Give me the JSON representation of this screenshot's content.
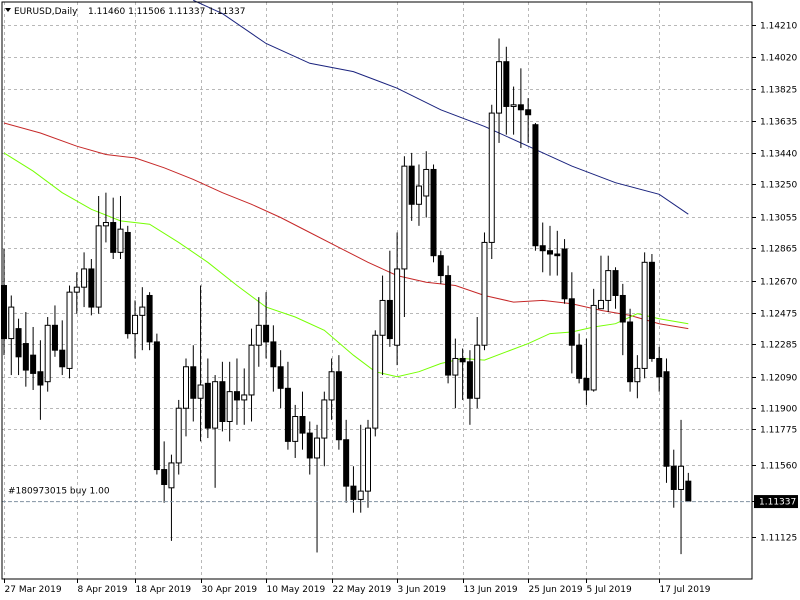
{
  "header": {
    "symbol_label": "EURUSD,Daily",
    "ohlc_label": "1.11460 1.11506 1.11337 1.11337"
  },
  "trade": {
    "label": "#180973015 buy 1.00",
    "price": 1.11337
  },
  "current_price": {
    "label": "1.11337",
    "value": 1.11337
  },
  "colors": {
    "background": "#ffffff",
    "grid": "#b8b8b8",
    "candle": "#000000",
    "ma_long": "#1a237e",
    "ma_mid": "#c62828",
    "ma_short": "#76ff03",
    "trade_line": "#8a9aaa",
    "price_label_bg": "#000000",
    "price_label_text": "#ffffff"
  },
  "chart_data": {
    "type": "candlestick",
    "title": "EURUSD,Daily",
    "ylim": [
      1.1087,
      1.1435
    ],
    "y_ticks": [
      1.11125,
      1.1134,
      1.1156,
      1.11775,
      1.119,
      1.1209,
      1.12285,
      1.12475,
      1.1267,
      1.12865,
      1.13055,
      1.1325,
      1.1344,
      1.13635,
      1.13825,
      1.1402,
      1.1421
    ],
    "y_tick_labels": [
      "1.11125",
      "",
      "1.11560",
      "1.11775",
      "1.11900",
      "1.12090",
      "1.12285",
      "1.12475",
      "1.12670",
      "1.12865",
      "1.13055",
      "1.13250",
      "1.13440",
      "1.13635",
      "1.13825",
      "1.14020",
      "1.14210"
    ],
    "x_labels": [
      {
        "i": 0,
        "label": "27 Mar 2019"
      },
      {
        "i": 10,
        "label": "8 Apr 2019"
      },
      {
        "i": 18,
        "label": "18 Apr 2019"
      },
      {
        "i": 27,
        "label": "30 Apr 2019"
      },
      {
        "i": 36,
        "label": "10 May 2019"
      },
      {
        "i": 45,
        "label": "22 May 2019"
      },
      {
        "i": 54,
        "label": "3 Jun 2019"
      },
      {
        "i": 63,
        "label": "13 Jun 2019"
      },
      {
        "i": 72,
        "label": "25 Jun 2019"
      },
      {
        "i": 80,
        "label": "5 Jul 2019"
      },
      {
        "i": 90,
        "label": "17 Jul 2019"
      }
    ],
    "candles": [
      {
        "o": 1.1264,
        "h": 1.1286,
        "l": 1.1222,
        "c": 1.1232
      },
      {
        "o": 1.1232,
        "h": 1.1258,
        "l": 1.121,
        "c": 1.1251
      },
      {
        "o": 1.1238,
        "h": 1.1244,
        "l": 1.121,
        "c": 1.1221
      },
      {
        "o": 1.1229,
        "h": 1.1248,
        "l": 1.1203,
        "c": 1.1213
      },
      {
        "o": 1.1222,
        "h": 1.1239,
        "l": 1.1201,
        "c": 1.1211
      },
      {
        "o": 1.1212,
        "h": 1.1231,
        "l": 1.1183,
        "c": 1.1204
      },
      {
        "o": 1.1206,
        "h": 1.1245,
        "l": 1.12,
        "c": 1.124
      },
      {
        "o": 1.124,
        "h": 1.1252,
        "l": 1.1221,
        "c": 1.1225
      },
      {
        "o": 1.1225,
        "h": 1.1243,
        "l": 1.121,
        "c": 1.1215
      },
      {
        "o": 1.1214,
        "h": 1.1264,
        "l": 1.1208,
        "c": 1.126
      },
      {
        "o": 1.126,
        "h": 1.1272,
        "l": 1.1247,
        "c": 1.1263
      },
      {
        "o": 1.1263,
        "h": 1.1284,
        "l": 1.1251,
        "c": 1.1274
      },
      {
        "o": 1.1274,
        "h": 1.128,
        "l": 1.1246,
        "c": 1.1251
      },
      {
        "o": 1.1251,
        "h": 1.1318,
        "l": 1.1247,
        "c": 1.13
      },
      {
        "o": 1.13,
        "h": 1.132,
        "l": 1.129,
        "c": 1.1302
      },
      {
        "o": 1.1302,
        "h": 1.1317,
        "l": 1.128,
        "c": 1.1284
      },
      {
        "o": 1.1284,
        "h": 1.1318,
        "l": 1.128,
        "c": 1.1298
      },
      {
        "o": 1.1296,
        "h": 1.13,
        "l": 1.1232,
        "c": 1.1235
      },
      {
        "o": 1.1235,
        "h": 1.1255,
        "l": 1.122,
        "c": 1.1246
      },
      {
        "o": 1.1246,
        "h": 1.1263,
        "l": 1.1225,
        "c": 1.1251
      },
      {
        "o": 1.1258,
        "h": 1.126,
        "l": 1.1225,
        "c": 1.123
      },
      {
        "o": 1.123,
        "h": 1.1235,
        "l": 1.115,
        "c": 1.1153
      },
      {
        "o": 1.1153,
        "h": 1.117,
        "l": 1.1133,
        "c": 1.1144
      },
      {
        "o": 1.1142,
        "h": 1.1162,
        "l": 1.111,
        "c": 1.1157
      },
      {
        "o": 1.1157,
        "h": 1.1195,
        "l": 1.115,
        "c": 1.119
      },
      {
        "o": 1.119,
        "h": 1.122,
        "l": 1.1173,
        "c": 1.1215
      },
      {
        "o": 1.1215,
        "h": 1.1228,
        "l": 1.1182,
        "c": 1.1196
      },
      {
        "o": 1.1196,
        "h": 1.1264,
        "l": 1.117,
        "c": 1.1204
      },
      {
        "o": 1.1205,
        "h": 1.122,
        "l": 1.1172,
        "c": 1.1178
      },
      {
        "o": 1.1178,
        "h": 1.121,
        "l": 1.1142,
        "c": 1.1206
      },
      {
        "o": 1.1206,
        "h": 1.1218,
        "l": 1.1176,
        "c": 1.1182
      },
      {
        "o": 1.1182,
        "h": 1.1218,
        "l": 1.117,
        "c": 1.12
      },
      {
        "o": 1.12,
        "h": 1.122,
        "l": 1.118,
        "c": 1.1195
      },
      {
        "o": 1.1195,
        "h": 1.1214,
        "l": 1.118,
        "c": 1.1198
      },
      {
        "o": 1.1198,
        "h": 1.1238,
        "l": 1.1182,
        "c": 1.1228
      },
      {
        "o": 1.1228,
        "h": 1.1257,
        "l": 1.1215,
        "c": 1.124
      },
      {
        "o": 1.124,
        "h": 1.126,
        "l": 1.122,
        "c": 1.123
      },
      {
        "o": 1.123,
        "h": 1.124,
        "l": 1.12,
        "c": 1.1215
      },
      {
        "o": 1.1215,
        "h": 1.1225,
        "l": 1.119,
        "c": 1.1202
      },
      {
        "o": 1.1202,
        "h": 1.1218,
        "l": 1.1165,
        "c": 1.117
      },
      {
        "o": 1.117,
        "h": 1.1192,
        "l": 1.116,
        "c": 1.1185
      },
      {
        "o": 1.1185,
        "h": 1.12,
        "l": 1.1165,
        "c": 1.1175
      },
      {
        "o": 1.1175,
        "h": 1.1182,
        "l": 1.115,
        "c": 1.116
      },
      {
        "o": 1.116,
        "h": 1.118,
        "l": 1.1103,
        "c": 1.1172
      },
      {
        "o": 1.1172,
        "h": 1.12,
        "l": 1.1155,
        "c": 1.1195
      },
      {
        "o": 1.1195,
        "h": 1.122,
        "l": 1.1183,
        "c": 1.1212
      },
      {
        "o": 1.1212,
        "h": 1.1222,
        "l": 1.1165,
        "c": 1.1171
      },
      {
        "o": 1.1171,
        "h": 1.1183,
        "l": 1.1133,
        "c": 1.1143
      },
      {
        "o": 1.1143,
        "h": 1.1155,
        "l": 1.1127,
        "c": 1.1135
      },
      {
        "o": 1.1135,
        "h": 1.118,
        "l": 1.1127,
        "c": 1.114
      },
      {
        "o": 1.114,
        "h": 1.1183,
        "l": 1.113,
        "c": 1.1178
      },
      {
        "o": 1.1178,
        "h": 1.1237,
        "l": 1.1173,
        "c": 1.1234
      },
      {
        "o": 1.1234,
        "h": 1.127,
        "l": 1.121,
        "c": 1.1255
      },
      {
        "o": 1.1255,
        "h": 1.1285,
        "l": 1.1227,
        "c": 1.1232
      },
      {
        "o": 1.1228,
        "h": 1.1296,
        "l": 1.1216,
        "c": 1.1274
      },
      {
        "o": 1.1274,
        "h": 1.1342,
        "l": 1.1245,
        "c": 1.1336
      },
      {
        "o": 1.1336,
        "h": 1.1344,
        "l": 1.1303,
        "c": 1.1313
      },
      {
        "o": 1.1313,
        "h": 1.1337,
        "l": 1.13,
        "c": 1.1324
      },
      {
        "o": 1.1318,
        "h": 1.1345,
        "l": 1.1305,
        "c": 1.1334
      },
      {
        "o": 1.1334,
        "h": 1.1337,
        "l": 1.1278,
        "c": 1.1282
      },
      {
        "o": 1.1282,
        "h": 1.1285,
        "l": 1.1265,
        "c": 1.127
      },
      {
        "o": 1.127,
        "h": 1.1276,
        "l": 1.1205,
        "c": 1.121
      },
      {
        "o": 1.121,
        "h": 1.1232,
        "l": 1.119,
        "c": 1.122
      },
      {
        "o": 1.122,
        "h": 1.1226,
        "l": 1.1195,
        "c": 1.1218
      },
      {
        "o": 1.1218,
        "h": 1.1225,
        "l": 1.118,
        "c": 1.1196
      },
      {
        "o": 1.1196,
        "h": 1.1245,
        "l": 1.119,
        "c": 1.1228
      },
      {
        "o": 1.1228,
        "h": 1.1296,
        "l": 1.1225,
        "c": 1.129
      },
      {
        "o": 1.129,
        "h": 1.1373,
        "l": 1.128,
        "c": 1.1368
      },
      {
        "o": 1.1368,
        "h": 1.1413,
        "l": 1.135,
        "c": 1.1399
      },
      {
        "o": 1.1399,
        "h": 1.1408,
        "l": 1.1355,
        "c": 1.1372
      },
      {
        "o": 1.1372,
        "h": 1.1384,
        "l": 1.1355,
        "c": 1.1373
      },
      {
        "o": 1.1373,
        "h": 1.1395,
        "l": 1.1347,
        "c": 1.137
      },
      {
        "o": 1.137,
        "h": 1.1377,
        "l": 1.135,
        "c": 1.1367
      },
      {
        "o": 1.1361,
        "h": 1.1362,
        "l": 1.1285,
        "c": 1.1288
      },
      {
        "o": 1.1288,
        "h": 1.1302,
        "l": 1.1272,
        "c": 1.1285
      },
      {
        "o": 1.1285,
        "h": 1.13,
        "l": 1.127,
        "c": 1.1283
      },
      {
        "o": 1.1283,
        "h": 1.1297,
        "l": 1.127,
        "c": 1.1282
      },
      {
        "o": 1.1286,
        "h": 1.1292,
        "l": 1.1253,
        "c": 1.1256
      },
      {
        "o": 1.1256,
        "h": 1.1272,
        "l": 1.1211,
        "c": 1.1228
      },
      {
        "o": 1.1228,
        "h": 1.1235,
        "l": 1.1205,
        "c": 1.1208
      },
      {
        "o": 1.1208,
        "h": 1.1232,
        "l": 1.1192,
        "c": 1.1201
      },
      {
        "o": 1.1201,
        "h": 1.1262,
        "l": 1.12,
        "c": 1.1252
      },
      {
        "o": 1.125,
        "h": 1.1282,
        "l": 1.125,
        "c": 1.1255
      },
      {
        "o": 1.1255,
        "h": 1.1282,
        "l": 1.1248,
        "c": 1.1273
      },
      {
        "o": 1.1273,
        "h": 1.1275,
        "l": 1.125,
        "c": 1.1258
      },
      {
        "o": 1.1258,
        "h": 1.1265,
        "l": 1.1222,
        "c": 1.1242
      },
      {
        "o": 1.1242,
        "h": 1.125,
        "l": 1.12,
        "c": 1.1206
      },
      {
        "o": 1.1206,
        "h": 1.1222,
        "l": 1.1196,
        "c": 1.1214
      },
      {
        "o": 1.1214,
        "h": 1.1284,
        "l": 1.1208,
        "c": 1.1278
      },
      {
        "o": 1.1278,
        "h": 1.1283,
        "l": 1.1218,
        "c": 1.122
      },
      {
        "o": 1.122,
        "h": 1.1227,
        "l": 1.12,
        "c": 1.1209
      },
      {
        "o": 1.1212,
        "h": 1.122,
        "l": 1.1145,
        "c": 1.1155
      },
      {
        "o": 1.1155,
        "h": 1.1165,
        "l": 1.113,
        "c": 1.1141
      },
      {
        "o": 1.1141,
        "h": 1.1183,
        "l": 1.1102,
        "c": 1.1155
      },
      {
        "o": 1.1146,
        "h": 1.1151,
        "l": 1.1134,
        "c": 1.1134
      }
    ],
    "ma_long": [
      [
        26,
        1.1436
      ],
      [
        30,
        1.1428
      ],
      [
        36,
        1.141
      ],
      [
        42,
        1.1398
      ],
      [
        48,
        1.1393
      ],
      [
        54,
        1.1383
      ],
      [
        60,
        1.137
      ],
      [
        66,
        1.136
      ],
      [
        72,
        1.1348
      ],
      [
        78,
        1.1336
      ],
      [
        84,
        1.1326
      ],
      [
        90,
        1.1319
      ],
      [
        94,
        1.1307
      ]
    ],
    "ma_mid": [
      [
        0,
        1.1362
      ],
      [
        5,
        1.1356
      ],
      [
        10,
        1.1348
      ],
      [
        14,
        1.1343
      ],
      [
        18,
        1.1341
      ],
      [
        22,
        1.1335
      ],
      [
        26,
        1.1328
      ],
      [
        30,
        1.132
      ],
      [
        34,
        1.1313
      ],
      [
        38,
        1.1305
      ],
      [
        42,
        1.1296
      ],
      [
        46,
        1.1287
      ],
      [
        50,
        1.1278
      ],
      [
        54,
        1.127
      ],
      [
        58,
        1.1266
      ],
      [
        62,
        1.1264
      ],
      [
        66,
        1.1258
      ],
      [
        70,
        1.1254
      ],
      [
        74,
        1.1255
      ],
      [
        78,
        1.1253
      ],
      [
        82,
        1.1249
      ],
      [
        86,
        1.1246
      ],
      [
        90,
        1.1241
      ],
      [
        94,
        1.1238
      ]
    ],
    "ma_short": [
      [
        0,
        1.1344
      ],
      [
        4,
        1.1333
      ],
      [
        8,
        1.132
      ],
      [
        12,
        1.131
      ],
      [
        16,
        1.1303
      ],
      [
        20,
        1.1301
      ],
      [
        24,
        1.129
      ],
      [
        28,
        1.1278
      ],
      [
        32,
        1.1264
      ],
      [
        36,
        1.1251
      ],
      [
        40,
        1.1245
      ],
      [
        44,
        1.1237
      ],
      [
        48,
        1.1222
      ],
      [
        51,
        1.1212
      ],
      [
        54,
        1.1209
      ],
      [
        57,
        1.1212
      ],
      [
        60,
        1.1217
      ],
      [
        63,
        1.122
      ],
      [
        66,
        1.1219
      ],
      [
        69,
        1.1224
      ],
      [
        72,
        1.1229
      ],
      [
        75,
        1.1235
      ],
      [
        78,
        1.1236
      ],
      [
        81,
        1.1239
      ],
      [
        84,
        1.1241
      ],
      [
        87,
        1.1247
      ],
      [
        90,
        1.1244
      ],
      [
        94,
        1.1241
      ]
    ]
  }
}
